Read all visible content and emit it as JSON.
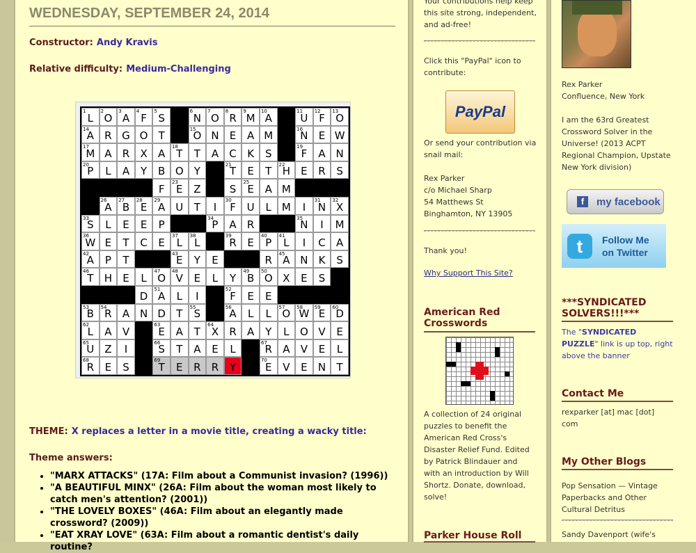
{
  "post": {
    "date": "WEDNESDAY, SEPTEMBER 24, 2014",
    "constructor_label": "Constructor:",
    "constructor_name": "Andy Kravis",
    "difficulty_label": "Relative difficulty:",
    "difficulty_value": "Medium-Challenging",
    "theme_label": "THEME:",
    "theme_value": "X replaces a letter in a movie title, creating a wacky title:",
    "theme_answers_label": "Theme answers:",
    "theme_answers": [
      "\"MARX ATTACKS\" (17A: Film about a Communist invasion? (1996))",
      "\"A BEAUTIFUL MINX\" (26A: Film about the woman most likely to catch men's attention? (2001))",
      "\"THE LOVELY BOXES\" (46A: Film about an elegantly made crossword? (2009))",
      "\"EAT XRAY LOVE\" (63A: Film about a romantic dentist's daily routine?"
    ]
  },
  "grid": {
    "rows": [
      "LOAFS#NORMA#UFO",
      "ARGOT#ONEAM#NEW",
      "MARXATTACKS#FAN",
      "PLAYBOY#TETHERS",
      "####FEZ#SEAM###",
      "#ABEAUTIFULMINX",
      "SLEEP##PAR##NIM",
      "WETCELL#REPLICA",
      "APT##EYE##RANKS",
      "THELOVELYBOXES#",
      "###DALI#FEE####",
      "BRANDTS#ALLOWED",
      "LAV#EATXRAYLOVE",
      "UZI#STAEL#RAVEL",
      "RES#TERRY#EVENT"
    ],
    "numbers": [
      [
        1,
        2,
        3,
        4,
        5,
        0,
        6,
        7,
        8,
        9,
        10,
        0,
        11,
        12,
        13
      ],
      [
        14,
        0,
        0,
        0,
        0,
        0,
        15,
        0,
        0,
        0,
        0,
        0,
        16,
        0,
        0
      ],
      [
        17,
        0,
        0,
        0,
        0,
        18,
        0,
        0,
        0,
        0,
        0,
        0,
        19,
        0,
        0
      ],
      [
        20,
        0,
        0,
        0,
        0,
        0,
        0,
        0,
        21,
        0,
        0,
        22,
        0,
        0,
        0
      ],
      [
        0,
        0,
        0,
        0,
        0,
        23,
        0,
        0,
        0,
        25,
        0,
        0,
        0,
        0,
        0
      ],
      [
        0,
        26,
        27,
        28,
        29,
        0,
        0,
        0,
        30,
        0,
        0,
        0,
        0,
        31,
        32
      ],
      [
        33,
        0,
        0,
        0,
        0,
        0,
        0,
        34,
        0,
        0,
        0,
        0,
        35,
        0,
        0
      ],
      [
        36,
        0,
        0,
        0,
        0,
        37,
        38,
        0,
        39,
        0,
        40,
        41,
        0,
        0,
        0
      ],
      [
        42,
        0,
        0,
        0,
        0,
        43,
        0,
        0,
        44,
        0,
        0,
        45,
        0,
        0,
        0
      ],
      [
        46,
        0,
        0,
        0,
        47,
        48,
        0,
        0,
        0,
        49,
        50,
        0,
        0,
        0,
        0
      ],
      [
        0,
        0,
        0,
        0,
        51,
        0,
        0,
        0,
        52,
        0,
        0,
        0,
        0,
        0,
        0
      ],
      [
        53,
        54,
        0,
        0,
        0,
        0,
        55,
        0,
        56,
        0,
        0,
        57,
        58,
        59,
        60,
        61
      ],
      [
        62,
        0,
        0,
        0,
        63,
        0,
        0,
        64,
        0,
        0,
        0,
        0,
        0,
        0,
        0
      ],
      [
        65,
        0,
        0,
        0,
        66,
        0,
        0,
        0,
        0,
        0,
        67,
        0,
        0,
        0,
        0
      ],
      [
        68,
        0,
        0,
        0,
        69,
        0,
        0,
        0,
        0,
        0,
        70,
        0,
        0,
        0,
        0
      ]
    ],
    "highlight": {
      "grey_row": 14,
      "grey_cols": [
        4,
        5,
        6,
        7
      ],
      "red_row": 14,
      "red_col": 8
    }
  },
  "sidebar1": {
    "top_text": "Your contributions help keep this site strong, independent, and ad-free!",
    "paypal_prompt": "Click this \"PayPal\" icon to contribute:",
    "paypal_button": "PayPal",
    "mail_prompt": "Or send your contribution via snail mail:",
    "address": [
      "Rex Parker",
      "c/o Michael Sharp",
      "54 Matthews St",
      "Binghamton, NY 13905"
    ],
    "thanks": "Thank you!",
    "why_support": "Why Support This Site?",
    "red_cross_title": "American Red Crosswords",
    "red_cross_desc": "A collection of 24 original puzzles to benefit the American Red Cross's Disaster Relief Fund. Edited by Patrick Blindauer and with an introduction by Will Shortz. Donate, download, solve!",
    "parker_house": "Parker House Roll"
  },
  "sidebar2": {
    "name": "Rex Parker",
    "location": "Confluence, New York",
    "bio": "I am the 63rd Greatest Crossword Solver in the Universe! (2013 ACPT Regional Champion, Upstate New York division)",
    "facebook_label": "my facebook",
    "twitter_label_1": "Follow Me",
    "twitter_label_2": "on Twitter",
    "syndicated_title": "***SYNDICATED SOLVERS!!!***",
    "syndicated_pre": "The \"",
    "syndicated_link": "SYNDICATED PUZZLE",
    "syndicated_post": "\" link is up top, right above the banner",
    "contact_title": "Contact Me",
    "contact_email": "rexparker [at] mac [dot] com",
    "blogs_title": "My Other Blogs",
    "blog1": "Pop Sensation — Vintage Paperbacks and Other Cultural Detritus",
    "blog2": "Sandy Davenport (wife's"
  }
}
